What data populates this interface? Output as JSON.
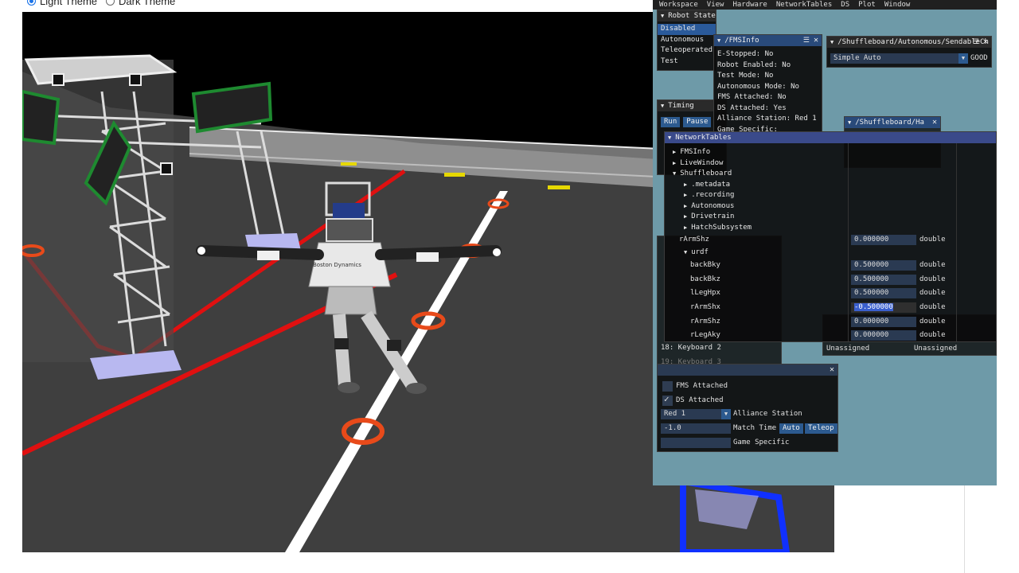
{
  "page": {
    "theme_light_label": "Light Theme",
    "theme_dark_label": "Dark Theme"
  },
  "menubar": [
    "Workspace",
    "View",
    "Hardware",
    "NetworkTables",
    "DS",
    "Plot",
    "Window"
  ],
  "robot_state": {
    "title": "Robot State",
    "modes": [
      "Disabled",
      "Autonomous",
      "Teleoperated",
      "Test"
    ],
    "selected": "Disabled"
  },
  "fms_info": {
    "title": "/FMSInfo",
    "rows": [
      "E-Stopped:  No",
      "Robot Enabled:  No",
      "Test Mode:  No",
      "Autonomous Mode:  No",
      "FMS Attached:  No",
      "DS Attached:  Yes",
      "Alliance Station:  Red 1",
      "Game Specific:"
    ]
  },
  "sendable_chooser": {
    "title": "/Shuffleboard/Autonomous/SendableCh",
    "selected": "Simple Auto",
    "status": "GOOD"
  },
  "timing": {
    "title": "Timing",
    "run_label": "Run",
    "pause_label": "Pause"
  },
  "shuffleboard_h": {
    "title": "/Shuffleboard/Ha"
  },
  "networktables": {
    "title": "NetworkTables",
    "tree": [
      {
        "label": "FMSInfo",
        "indent": 0
      },
      {
        "label": "LiveWindow",
        "indent": 0
      },
      {
        "label": "Shuffleboard",
        "indent": 0,
        "open": true
      },
      {
        "label": ".metadata",
        "indent": 1
      },
      {
        "label": ".recording",
        "indent": 1
      },
      {
        "label": "Autonomous",
        "indent": 1
      },
      {
        "label": "Drivetrain",
        "indent": 1
      },
      {
        "label": "HatchSubsystem",
        "indent": 1
      }
    ],
    "top_entry": {
      "name": "rArmShz",
      "value": "0.000000",
      "type": "double"
    },
    "urdf_label": "urdf",
    "entries": [
      {
        "name": "backBky",
        "value": "0.500000",
        "type": "double"
      },
      {
        "name": "backBkz",
        "value": "0.500000",
        "type": "double"
      },
      {
        "name": "lLegHpx",
        "value": "0.500000",
        "type": "double"
      },
      {
        "name": "rArmShx",
        "value": "-0.500000",
        "type": "double",
        "editing": true
      },
      {
        "name": "rArmShz",
        "value": "0.000000",
        "type": "double"
      },
      {
        "name": "rLegAky",
        "value": "0.000000",
        "type": "double"
      }
    ]
  },
  "joysticks_peek": {
    "rows": [
      "18: Keyboard 2",
      "19: Keyboard 3"
    ],
    "unassigned_left": "Unassigned",
    "unassigned_right": "Unassigned"
  },
  "fms_panel": {
    "fms_attached_label": "FMS Attached",
    "fms_attached": false,
    "ds_attached_label": "DS Attached",
    "ds_attached": true,
    "alliance_value": "Red 1",
    "alliance_label": "Alliance Station",
    "match_time_value": "-1.0",
    "match_time_label": "Match Time",
    "auto_label": "Auto",
    "teleop_label": "Teleop",
    "game_specific_label": "Game Specific",
    "game_specific_value": ""
  },
  "colors": {
    "sim_bg": "#6e9aa8",
    "title_active": "#294a7a",
    "button": "#2c5a8f",
    "field_red": "#e01010",
    "field_blue": "#1030ff",
    "ring_orange": "#e84a1a"
  }
}
